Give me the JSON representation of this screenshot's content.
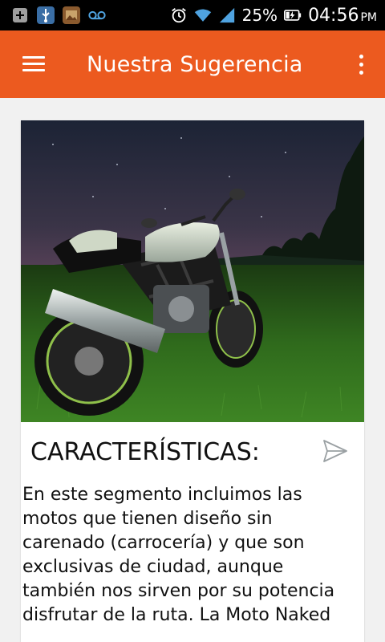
{
  "status_bar": {
    "battery_percent": "25%",
    "time": "04:56",
    "ampm": "PM",
    "icons": [
      "add-box-icon",
      "usb-icon",
      "gallery-icon",
      "voicemail-icon",
      "alarm-icon",
      "wifi-icon",
      "signal-icon",
      "battery-charging-icon"
    ]
  },
  "app_bar": {
    "title": "Nuestra Sugerencia",
    "background": "#ec5a1f"
  },
  "card": {
    "image_alt": "motorcycle-photo",
    "title": "CARACTERÍSTICAS:",
    "body": "En este segmento incluimos las motos que tienen diseño sin carenado (carrocería) y que son exclusivas de ciudad, aunque también nos sirven por su potencia disfrutar de la ruta. La Moto Naked"
  }
}
